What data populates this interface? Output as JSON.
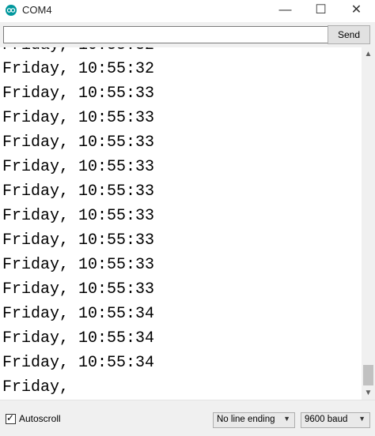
{
  "window": {
    "title": "COM4",
    "minimize_glyph": "—",
    "maximize_glyph": "☐",
    "close_glyph": "✕",
    "icon": "arduino-logo-icon",
    "accent_color": "#00979d"
  },
  "send_row": {
    "input_value": "",
    "send_label": "Send"
  },
  "output": {
    "lines": [
      "Friday, 10:55:32",
      "Friday, 10:55:32",
      "Friday, 10:55:33",
      "Friday, 10:55:33",
      "Friday, 10:55:33",
      "Friday, 10:55:33",
      "Friday, 10:55:33",
      "Friday, 10:55:33",
      "Friday, 10:55:33",
      "Friday, 10:55:33",
      "Friday, 10:55:33",
      "Friday, 10:55:34",
      "Friday, 10:55:34",
      "Friday, 10:55:34",
      "Friday,"
    ]
  },
  "bottom_bar": {
    "autoscroll_label": "Autoscroll",
    "autoscroll_checked": true,
    "line_ending": "No line ending",
    "baud_rate": "9600 baud"
  }
}
